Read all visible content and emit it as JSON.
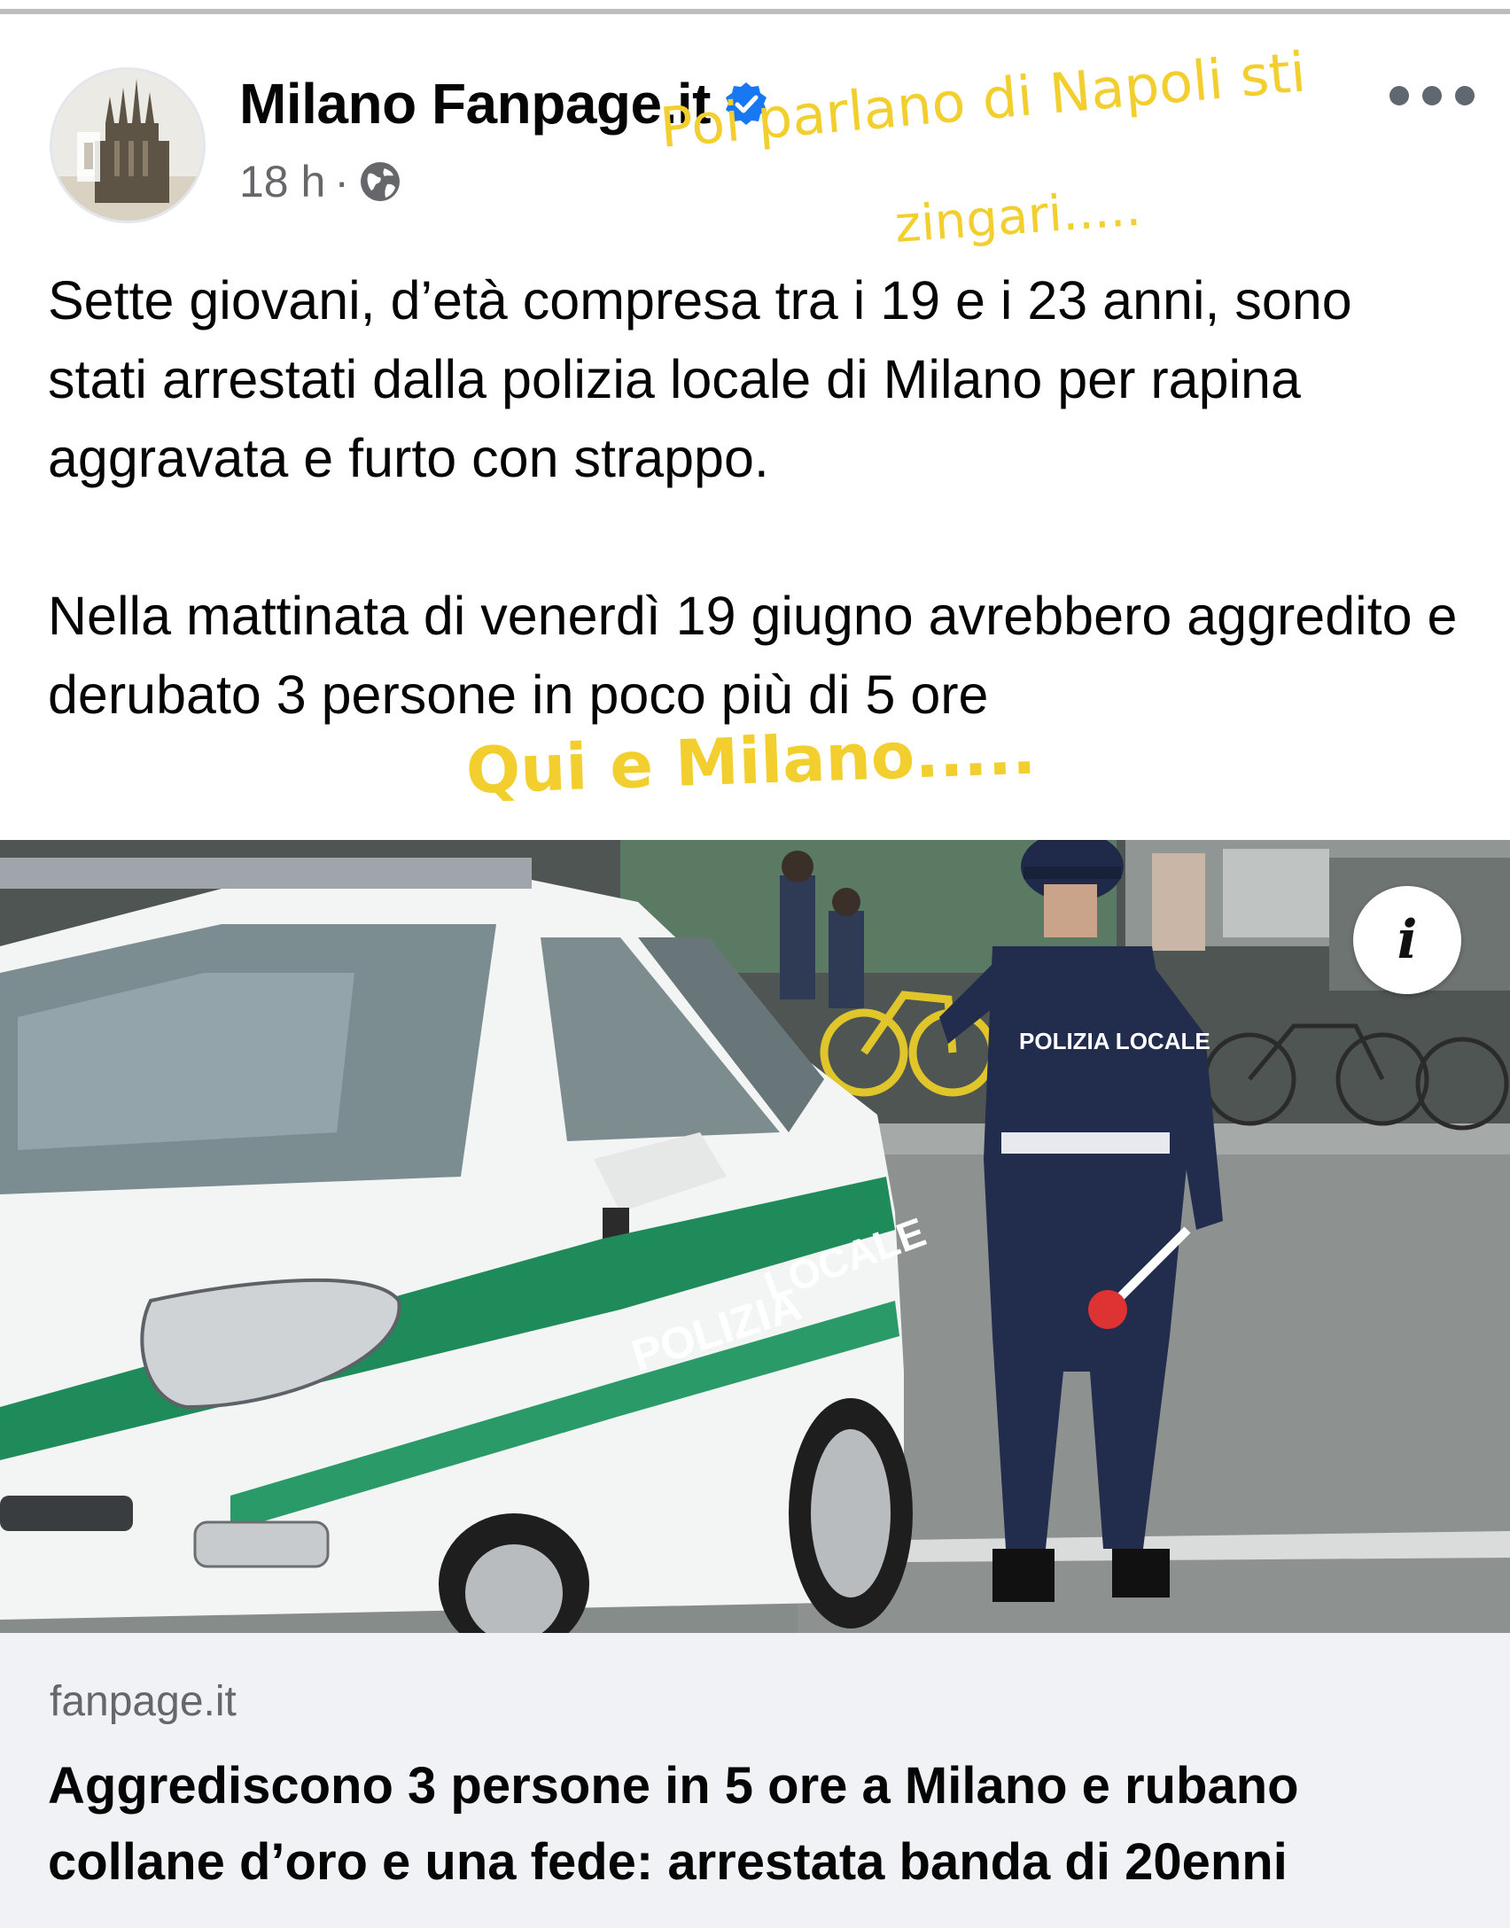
{
  "post": {
    "page_name": "Milano Fanpage.it",
    "time": "18 h",
    "separator": "·",
    "verified_icon": "verified-badge-icon",
    "privacy_icon": "globe-icon",
    "more_icon": "more-options-icon",
    "paragraphs": [
      "Sette giovani, d’età compresa tra i 19 e i 23 anni, sono stati arrestati dalla polizia locale di Milano per rapina aggravata e furto con strappo.",
      "Nella mattinata di venerdì 19 giugno avrebbero aggredito e derubato 3 persone in poco più di 5 ore"
    ]
  },
  "overlay_captions": {
    "line1": "Poi parlano di Napoli sti",
    "line2": "zingari.....",
    "line3": "Qui e Milano....."
  },
  "photo": {
    "car_text_door": "POLIZIA",
    "car_text_rear": "LOCALE",
    "officer_back_text": "POLIZIA LOCALE",
    "info_button_glyph": "i"
  },
  "link_preview": {
    "domain": "fanpage.it",
    "title": "Aggrediscono 3 persone in 5 ore a Milano e rubano collane d’oro e una fede: arrestata banda di 20enni"
  },
  "colors": {
    "overlay_yellow": "#f2cf2e",
    "verified_blue": "#1877f2",
    "secondary_text": "#65676b",
    "preview_bg": "#f0f2f5"
  }
}
